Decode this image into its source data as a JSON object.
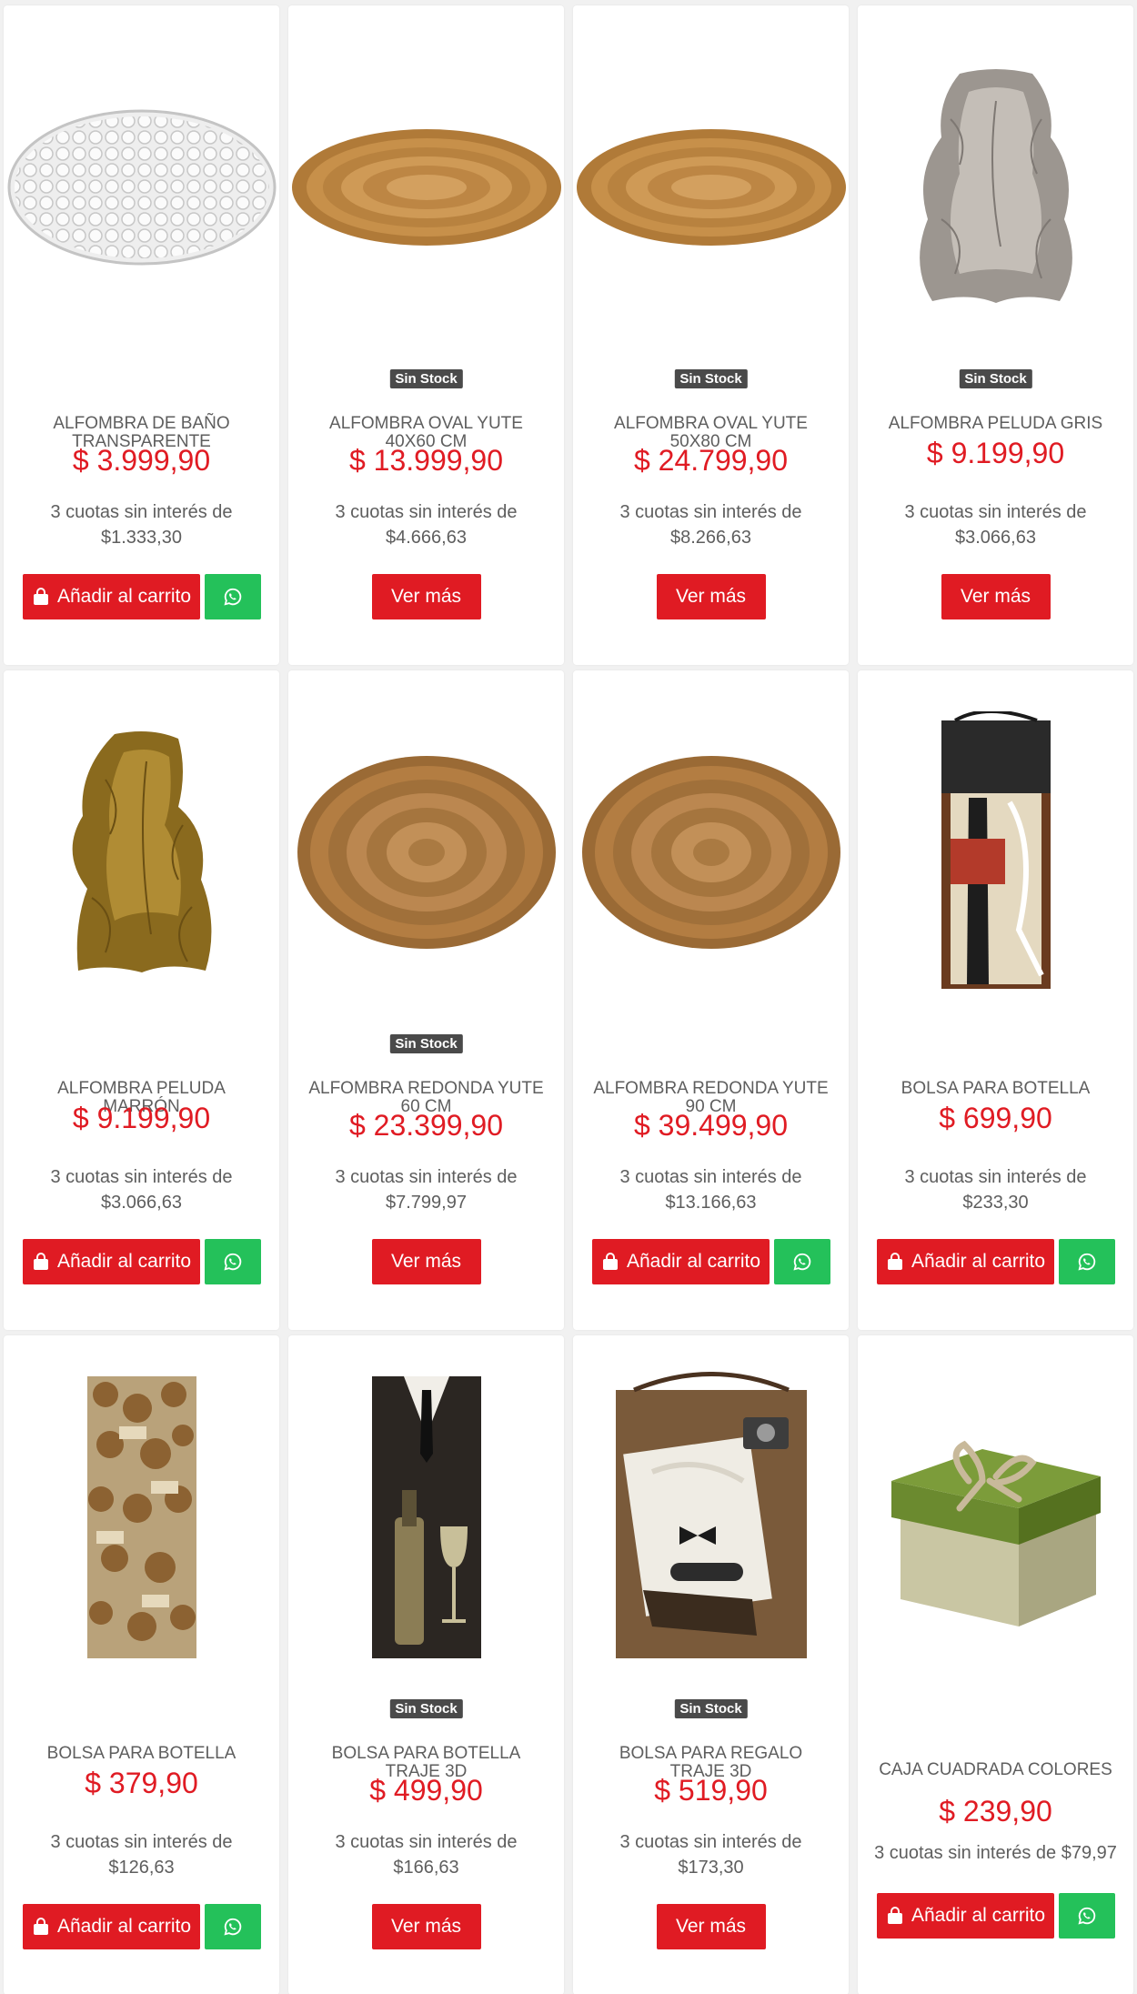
{
  "labels": {
    "badge": "Sin Stock",
    "add_to_cart": "Añadir al carrito",
    "see_more": "Ver más",
    "installments_prefix": "3 cuotas sin interés de"
  },
  "colors": {
    "accent": "#e01b23",
    "whatsapp": "#24c15a",
    "badge": "#4a4a4a"
  },
  "products": [
    {
      "name": "ALFOMBRA DE BAÑO TRANSPARENTE",
      "price": "$ 3.999,90",
      "installment": "$1.333,30",
      "out_of_stock": false,
      "image": "clear-bath-mat"
    },
    {
      "name": "ALFOMBRA OVAL YUTE 40X60 CM",
      "price": "$ 13.999,90",
      "installment": "$4.666,63",
      "out_of_stock": true,
      "image": "oval-jute-rug"
    },
    {
      "name": "ALFOMBRA OVAL YUTE 50X80 CM",
      "price": "$ 24.799,90",
      "installment": "$8.266,63",
      "out_of_stock": true,
      "image": "oval-jute-rug"
    },
    {
      "name": "ALFOMBRA PELUDA GRIS",
      "price": "$ 9.199,90",
      "installment": "$3.066,63",
      "out_of_stock": true,
      "image": "grey-fur-rug"
    },
    {
      "name": "ALFOMBRA PELUDA MARRÓN",
      "price": "$ 9.199,90",
      "installment": "$3.066,63",
      "out_of_stock": false,
      "image": "brown-fur-rug"
    },
    {
      "name": "ALFOMBRA REDONDA YUTE 60 CM",
      "price": "$ 23.399,90",
      "installment": "$7.799,97",
      "out_of_stock": true,
      "image": "round-jute-rug"
    },
    {
      "name": "ALFOMBRA REDONDA YUTE 90 CM",
      "price": "$ 39.499,90",
      "installment": "$13.166,63",
      "out_of_stock": false,
      "image": "round-jute-rug"
    },
    {
      "name": "BOLSA PARA BOTELLA",
      "price": "$ 699,90",
      "installment": "$233,30",
      "out_of_stock": false,
      "image": "wine-bottle-bag"
    },
    {
      "name": "BOLSA PARA BOTELLA",
      "price": "$ 379,90",
      "installment": "$126,63",
      "out_of_stock": false,
      "image": "cork-bottle-bag"
    },
    {
      "name": "BOLSA PARA BOTELLA TRAJE 3D",
      "price": "$ 499,90",
      "installment": "$166,63",
      "out_of_stock": true,
      "image": "suit-bottle-bag"
    },
    {
      "name": "BOLSA PARA REGALO TRAJE 3D",
      "price": "$ 519,90",
      "installment": "$173,30",
      "out_of_stock": true,
      "image": "suit-gift-bag"
    },
    {
      "name": "CAJA CUADRADA COLORES",
      "price": "$ 239,90",
      "installment": "$79,97",
      "out_of_stock": false,
      "image": "green-gift-box"
    }
  ]
}
